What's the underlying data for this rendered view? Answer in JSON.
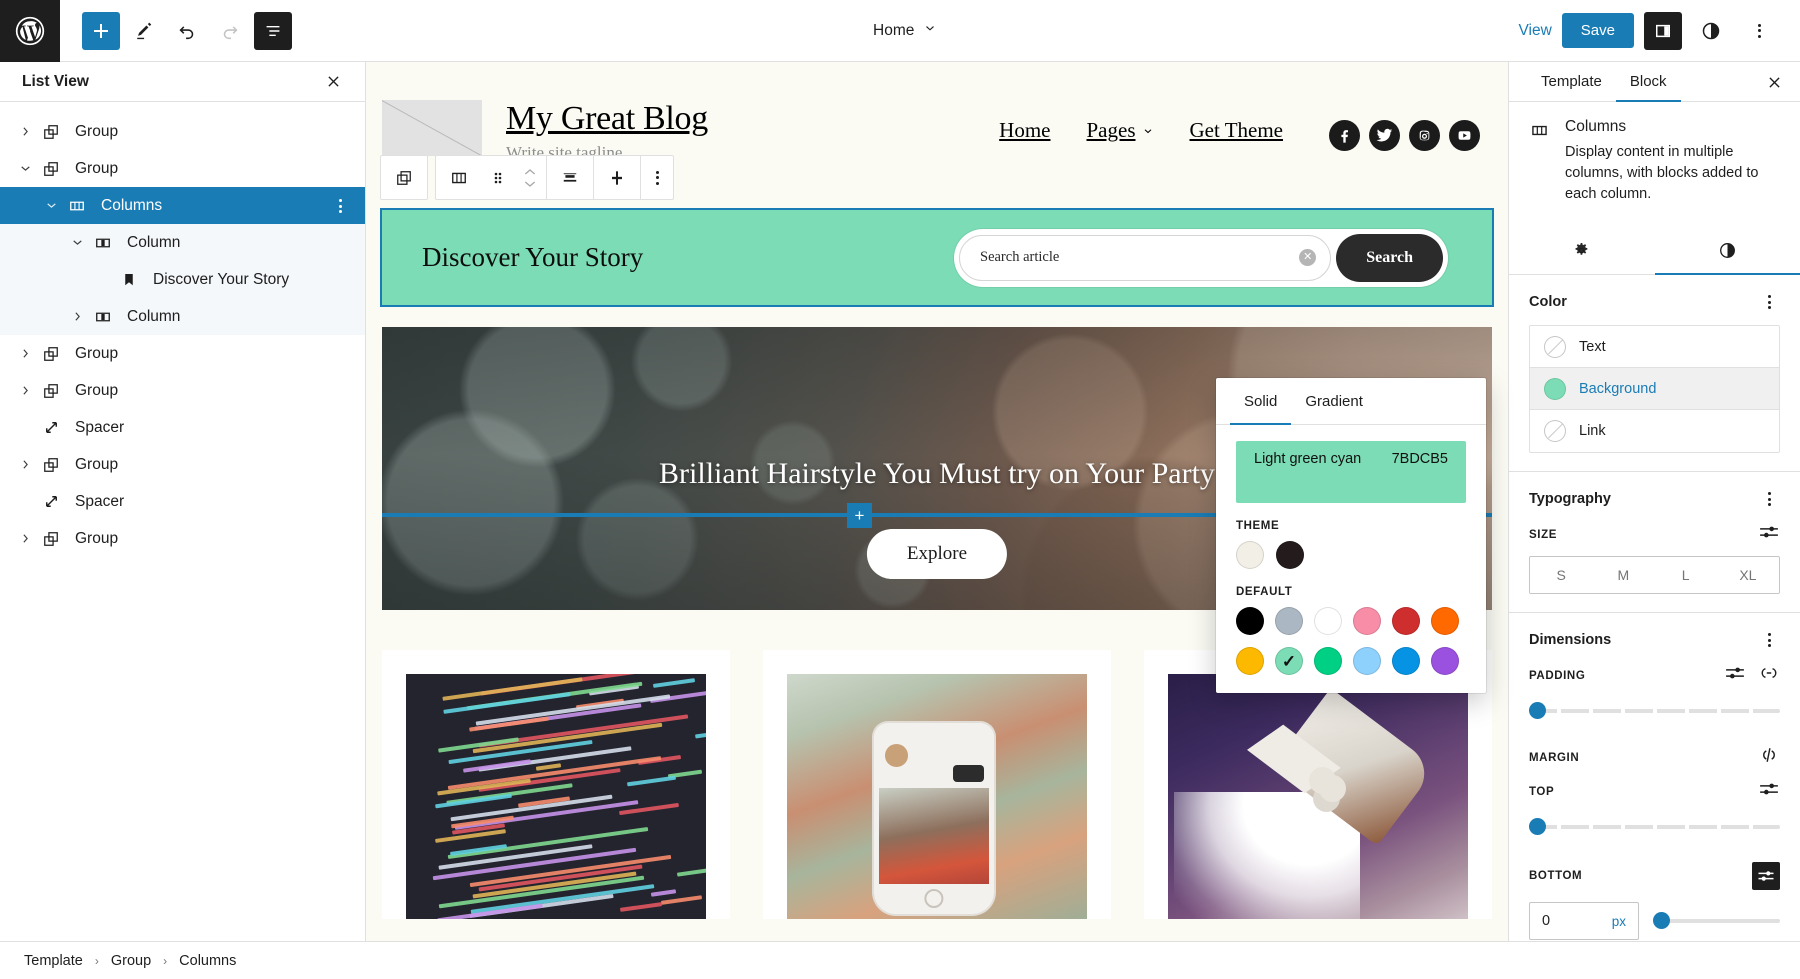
{
  "topbar": {
    "logo_icon": "wordpress-logo-icon",
    "add_block_icon": "plus-icon",
    "tools_icon": "pencil-edit-icon",
    "undo_icon": "undo-arrow-icon",
    "redo_icon": "redo-arrow-icon",
    "listview_icon": "list-view-icon",
    "document_title": "Home",
    "document_chevron_icon": "chevron-down-icon",
    "view_label": "View",
    "save_label": "Save",
    "settings_sidebar_icon": "sidebar-panel-icon",
    "styles_icon": "contrast-half-circle-icon",
    "options_icon": "three-dots-vertical-icon"
  },
  "list_view": {
    "title": "List View",
    "close_icon": "close-x-icon",
    "rows": [
      {
        "label": "Group",
        "icon": "group-block-icon",
        "indent": 0,
        "chevron": "right",
        "state": ""
      },
      {
        "label": "Group",
        "icon": "group-block-icon",
        "indent": 0,
        "chevron": "down",
        "state": ""
      },
      {
        "label": "Columns",
        "icon": "columns-block-icon",
        "indent": 1,
        "chevron": "down",
        "state": "selected",
        "more_icon": "three-dots-vertical-icon"
      },
      {
        "label": "Column",
        "icon": "column-block-icon",
        "indent": 2,
        "chevron": "down",
        "state": "subtree"
      },
      {
        "label": "Discover Your Story",
        "icon": "heading-bookmark-icon",
        "indent": 3,
        "chevron": "none",
        "state": "subtree"
      },
      {
        "label": "Column",
        "icon": "column-block-icon",
        "indent": 2,
        "chevron": "right",
        "state": "subtree"
      },
      {
        "label": "Group",
        "icon": "group-block-icon",
        "indent": 0,
        "chevron": "right",
        "state": ""
      },
      {
        "label": "Group",
        "icon": "group-block-icon",
        "indent": 0,
        "chevron": "right",
        "state": ""
      },
      {
        "label": "Spacer",
        "icon": "spacer-block-icon",
        "indent": 0,
        "chevron": "none",
        "state": ""
      },
      {
        "label": "Group",
        "icon": "group-block-icon",
        "indent": 0,
        "chevron": "right",
        "state": ""
      },
      {
        "label": "Spacer",
        "icon": "spacer-block-icon",
        "indent": 0,
        "chevron": "none",
        "state": ""
      },
      {
        "label": "Group",
        "icon": "group-block-icon",
        "indent": 0,
        "chevron": "right",
        "state": ""
      }
    ]
  },
  "block_toolbar": {
    "parent_block_icon": "group-block-icon",
    "block_type_icon": "columns-block-icon",
    "drag_handle_icon": "drag-dots-icon",
    "move_up_icon": "chevron-up-icon",
    "move_down_icon": "chevron-down-icon",
    "vertical_align_icon": "vertical-align-icon",
    "add_column_icon": "plus-thick-icon",
    "more_options_icon": "three-dots-vertical-icon"
  },
  "site": {
    "logo_icon": "site-logo-placeholder-icon",
    "title": "My Great Blog",
    "tagline": "Write site tagline",
    "nav": [
      {
        "label": "Home",
        "has_chevron": false
      },
      {
        "label": "Pages",
        "has_chevron": true
      },
      {
        "label": "Get Theme",
        "has_chevron": false
      }
    ],
    "nav_chevron_icon": "chevron-down-icon",
    "socials": [
      {
        "name": "facebook-icon"
      },
      {
        "name": "twitter-icon"
      },
      {
        "name": "instagram-icon"
      },
      {
        "name": "youtube-icon"
      }
    ]
  },
  "hero_search": {
    "heading": "Discover Your Story",
    "search_value": "Search article",
    "search_placeholder": "Search article",
    "clear_icon": "clear-circle-x-icon",
    "button_label": "Search",
    "background_color": "#7BDCB5"
  },
  "hero_banner": {
    "headline": "Brilliant Hairstyle You Must try on Your Party",
    "cta_label": "Explore",
    "inserter_icon": "plus-icon",
    "inserter_color": "#1a7cb5",
    "image_alt": "woman-with-curly-hair-photo"
  },
  "cards": [
    {
      "image_alt": "code-editor-screenshot"
    },
    {
      "image_alt": "hand-holding-phone-photo"
    },
    {
      "image_alt": "rocket-launch-photo"
    }
  ],
  "color_popover": {
    "tabs": [
      {
        "label": "Solid",
        "active": true
      },
      {
        "label": "Gradient",
        "active": false
      }
    ],
    "preview": {
      "name": "Light green cyan",
      "hex_label": "7BDCB5",
      "color": "#7BDCB5"
    },
    "theme_label": "THEME",
    "theme_swatches": [
      {
        "name": "off-white",
        "color": "#f2f0e6",
        "selected": false
      },
      {
        "name": "near-black",
        "color": "#241c1c",
        "selected": false
      }
    ],
    "default_label": "DEFAULT",
    "default_swatches": [
      {
        "name": "black",
        "color": "#000000",
        "selected": false
      },
      {
        "name": "cyan-bluish-gray",
        "color": "#abb8c3",
        "selected": false
      },
      {
        "name": "white",
        "color": "#ffffff",
        "selected": false
      },
      {
        "name": "pale-pink",
        "color": "#f78da7",
        "selected": false
      },
      {
        "name": "vivid-red",
        "color": "#cf2e2e",
        "selected": false
      },
      {
        "name": "luminous-orange",
        "color": "#ff6900",
        "selected": false
      },
      {
        "name": "luminous-amber",
        "color": "#fcb900",
        "selected": false
      },
      {
        "name": "light-green-cyan",
        "color": "#7bdcb5",
        "selected": true
      },
      {
        "name": "vivid-green-cyan",
        "color": "#00d084",
        "selected": false
      },
      {
        "name": "pale-cyan-blue",
        "color": "#8ed1fc",
        "selected": false
      },
      {
        "name": "vivid-cyan-blue",
        "color": "#0693e3",
        "selected": false
      },
      {
        "name": "vivid-purple",
        "color": "#9b51e0",
        "selected": false
      }
    ]
  },
  "inspector": {
    "tabs": [
      {
        "label": "Template",
        "active": false
      },
      {
        "label": "Block",
        "active": true
      }
    ],
    "close_icon": "close-x-icon",
    "block": {
      "icon": "columns-block-icon",
      "name": "Columns",
      "description": "Display content in multiple columns, with blocks added to each column."
    },
    "inner_tabs": [
      {
        "name": "settings-gear-icon",
        "active": false
      },
      {
        "name": "styles-contrast-icon",
        "active": true
      }
    ],
    "color_panel": {
      "title": "Color",
      "more_icon": "three-dots-vertical-icon",
      "rows": [
        {
          "label": "Text",
          "color": null,
          "active": false
        },
        {
          "label": "Background",
          "color": "#7BDCB5",
          "active": true
        },
        {
          "label": "Link",
          "color": null,
          "active": false
        }
      ]
    },
    "typography_panel": {
      "title": "Typography",
      "more_icon": "three-dots-vertical-icon",
      "size_label": "SIZE",
      "size_tools_icon": "sliders-icon",
      "size_options": [
        "S",
        "M",
        "L",
        "XL"
      ]
    },
    "dimensions_panel": {
      "title": "Dimensions",
      "more_icon": "three-dots-vertical-icon",
      "padding_label": "PADDING",
      "padding_tools_icon": "sliders-icon",
      "padding_link_icon": "link-sides-icon",
      "margin_label": "MARGIN",
      "margin_unlink_icon": "unlink-sides-icon",
      "top_label": "TOP",
      "top_tools_icon": "sliders-icon",
      "bottom_label": "BOTTOM",
      "bottom_tools_icon": "sliders-icon",
      "bottom_value": "0",
      "bottom_unit": "px"
    }
  },
  "footer": {
    "crumbs": [
      "Template",
      "Group",
      "Columns"
    ],
    "separator": "›"
  },
  "accent_color": "#1a7cb5"
}
